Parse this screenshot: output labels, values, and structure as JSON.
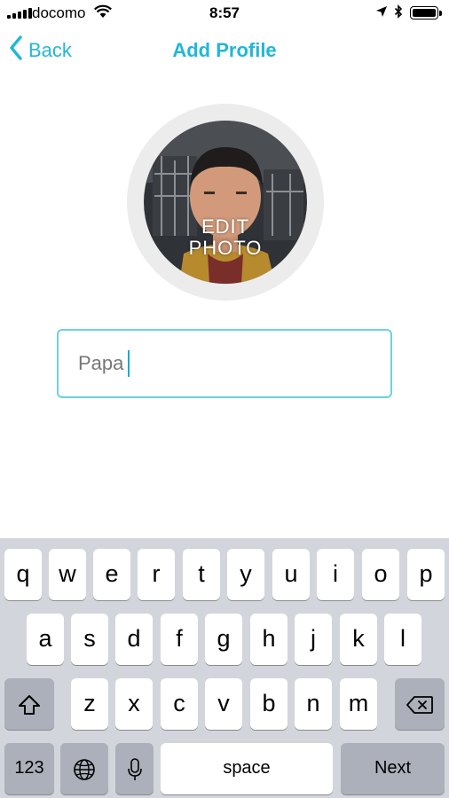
{
  "status_bar": {
    "carrier": "docomo",
    "time": "8:57"
  },
  "nav": {
    "back_label": "Back",
    "title": "Add Profile"
  },
  "avatar": {
    "edit_label": "EDIT\nPHOTO"
  },
  "name_field": {
    "value": "Papa"
  },
  "keyboard": {
    "row1": [
      "q",
      "w",
      "e",
      "r",
      "t",
      "y",
      "u",
      "i",
      "o",
      "p"
    ],
    "row2": [
      "a",
      "s",
      "d",
      "f",
      "g",
      "h",
      "j",
      "k",
      "l"
    ],
    "row3": [
      "z",
      "x",
      "c",
      "v",
      "b",
      "n",
      "m"
    ],
    "numbers_label": "123",
    "space_label": "space",
    "next_label": "Next"
  },
  "colors": {
    "accent": "#22b6d9",
    "field_border": "#6fd1de",
    "keyboard_bg": "#d2d5db"
  },
  "icons": [
    "signal-icon",
    "wifi-icon",
    "location-icon",
    "bluetooth-icon",
    "battery-icon",
    "chevron-left-icon",
    "shift-icon",
    "delete-icon",
    "globe-icon",
    "microphone-icon"
  ]
}
